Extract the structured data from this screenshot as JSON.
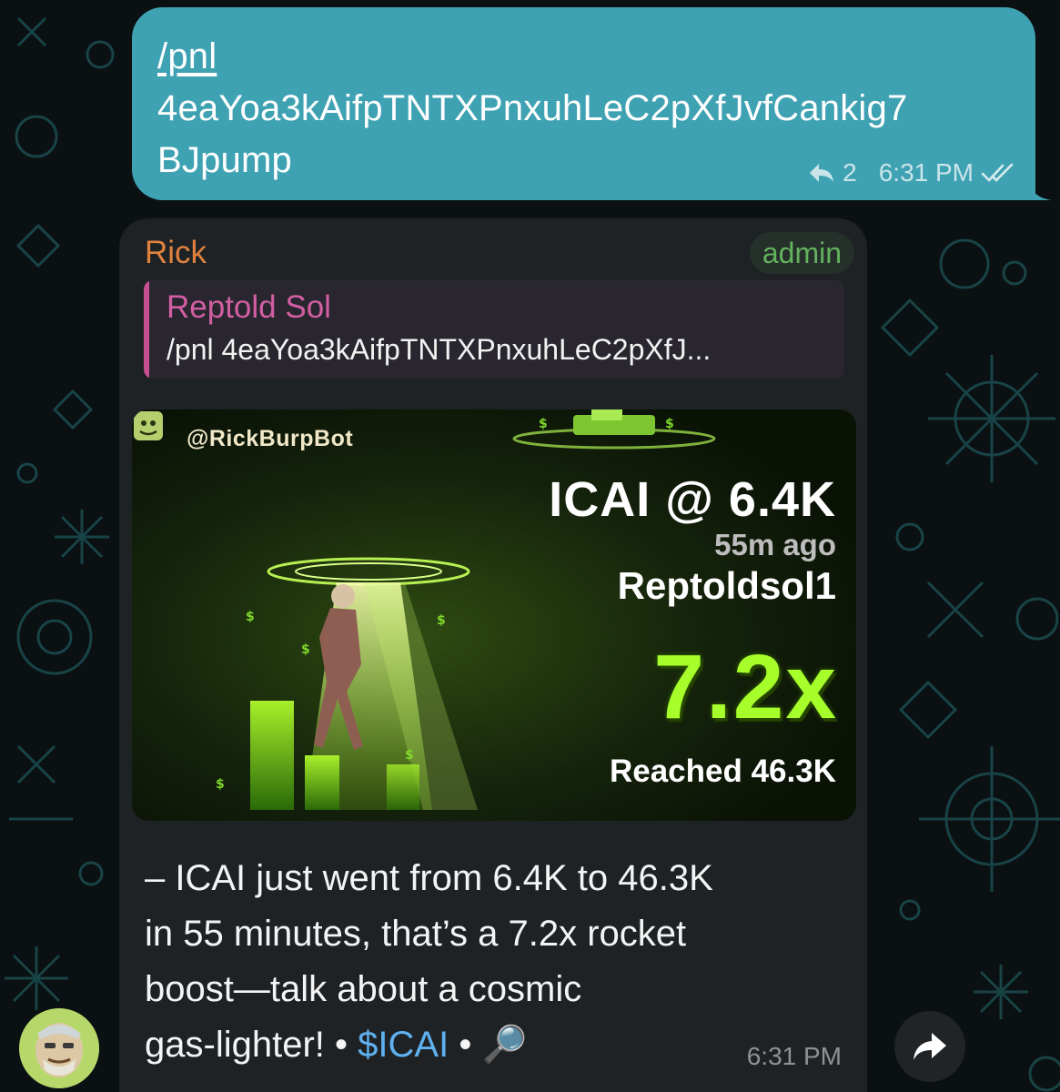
{
  "outgoing": {
    "command": "/pnl",
    "address_line1": "4eaYoa3kAifpTNTXPnxuhLeC2pXfJvfCankig7",
    "address_line2": "BJpump",
    "replies": "2",
    "time": "6:31 PM",
    "status": "read"
  },
  "incoming": {
    "sender": "Rick",
    "badge": "admin",
    "reply_to": {
      "name": "Reptold Sol",
      "text": "/pnl 4eaYoa3kAifpTNTXPnxuhLeC2pXfJ..."
    },
    "pnl_card": {
      "bot_handle": "@RickBurpBot",
      "ticker_line": "ICAI @ 6.4K",
      "ago": "55m ago",
      "user": "Reptoldsol1",
      "multiplier": "7.2x",
      "reached": "Reached 46.3K"
    },
    "text_lines": [
      "– ICAI just went from 6.4K to 46.3K",
      "in 55 minutes, that’s a 7.2x rocket",
      "boost—talk about a cosmic"
    ],
    "last_line_text": "gas-lighter!",
    "separator": "•",
    "cashtag": "$ICAI",
    "magnifier_glyph": "🔎",
    "time": "6:31 PM"
  },
  "icons": {
    "reply_arrow": "reply-arrow-icon",
    "read_check": "double-check-icon",
    "forward": "forward-arrow-icon",
    "magnifier": "magnifier-icon"
  },
  "colors": {
    "outgoing_bubble": "#3fa2b3",
    "incoming_bubble": "#1e2225",
    "sender": "#e0823f",
    "admin": "#63b25e",
    "reply_accent": "#c54f8f",
    "multiplier": "#a6ff2a",
    "cashtag": "#5fb0ee"
  }
}
